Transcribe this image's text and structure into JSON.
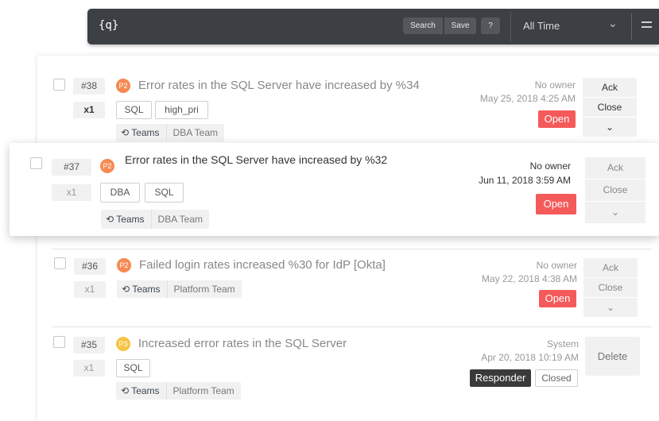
{
  "search": {
    "query_icon": "{q}",
    "search_label": "Search",
    "save_label": "Save",
    "help_label": "?",
    "time_range": "All Time",
    "chevron": "⌄",
    "menu_icon": "hamburger-icon"
  },
  "alerts": [
    {
      "id": "#38",
      "count": "x1",
      "priority": "P2",
      "title": "Error rates in the SQL Server have increased by %34",
      "tags": [
        "SQL",
        "high_pri"
      ],
      "teams_label": "Teams",
      "team": "DBA Team",
      "owner": "No owner",
      "date": "May 25, 2018 4:25 AM",
      "status": "Open",
      "actions": [
        "Ack",
        "Close",
        "⌄"
      ]
    },
    {
      "id": "#37",
      "count": "x1",
      "priority": "P2",
      "title": "Error rates in the SQL Server have increased by %32",
      "tags": [
        "DBA",
        "SQL"
      ],
      "teams_label": "Teams",
      "team": "DBA Team",
      "owner": "No owner",
      "date": "Jun 11, 2018 3:59 AM",
      "status": "Open",
      "actions": [
        "Ack",
        "Close",
        "⌄"
      ]
    },
    {
      "id": "#36",
      "count": "x1",
      "priority": "P2",
      "title": "Failed login rates increased %30 for IdP [Okta]",
      "tags": [],
      "teams_label": "Teams",
      "team": "Platform Team",
      "owner": "No owner",
      "date": "May 22, 2018 4:38 AM",
      "status": "Open",
      "actions": [
        "Ack",
        "Close",
        "⌄"
      ]
    },
    {
      "id": "#35",
      "count": "x1",
      "priority": "P3",
      "title": "Increased error rates in the SQL Server",
      "tags": [
        "SQL"
      ],
      "teams_label": "Teams",
      "team": "Platform Team",
      "owner": "System",
      "date": "Apr 20, 2018 10:19 AM",
      "responder_label": "Responder",
      "status": "Closed",
      "actions": [
        "Delete"
      ]
    }
  ],
  "colors": {
    "open": "#f55a5a",
    "p2": "#f68a52",
    "p3": "#f5c441",
    "toolbar": "#3c3f43"
  }
}
